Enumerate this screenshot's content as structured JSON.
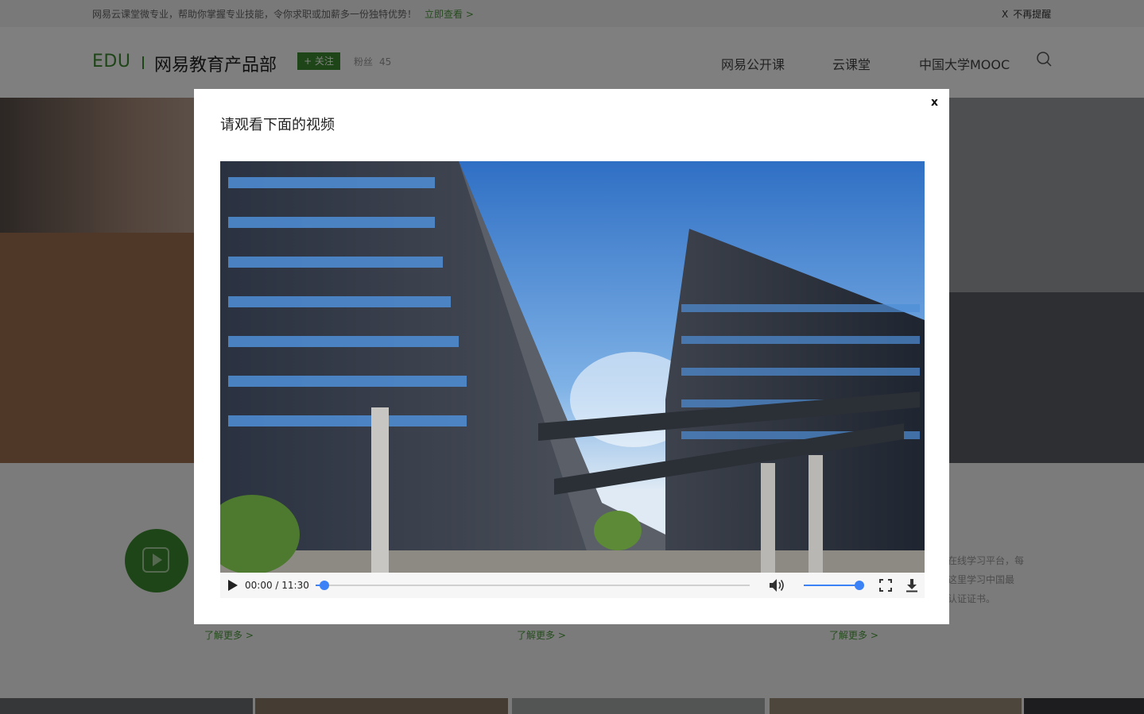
{
  "topbar": {
    "notice": "网易云课堂微专业，帮助你掌握专业技能，令你求职或加薪多一份独特优势！",
    "notice_link": "立即查看 >",
    "dismiss_mark": "X",
    "dismiss_label": "不再提醒"
  },
  "header": {
    "logo": "EDU",
    "dept_name": "网易教育产品部",
    "follow_label": "+ 关注",
    "fans_label": "粉丝",
    "fans_count": "45",
    "nav": [
      "网易公开课",
      "云课堂",
      "中国大学MOOC"
    ],
    "search_icon": "search-icon"
  },
  "features": {
    "desc_lines": [
      "的在线学习平台，每",
      "在这里学习中国最",
      "等认证证书。"
    ],
    "learn_more": [
      "了解更多 >",
      "了解更多 >",
      "了解更多 >"
    ],
    "video_icon": "video-play-icon"
  },
  "modal": {
    "close_label": "x",
    "title": "请观看下面的视频",
    "player": {
      "current_time": "00:00",
      "duration": "11:30",
      "time_display": "00:00 / 11:30",
      "progress_fraction": 0.02,
      "volume_fraction": 1.0,
      "icons": [
        "play-icon",
        "volume-icon",
        "fullscreen-icon",
        "download-icon"
      ]
    }
  },
  "colors": {
    "brand_green": "#3d8b2e",
    "link_green": "#4a9a3a",
    "player_accent": "#3b82f6",
    "overlay": "rgba(0,0,0,0.5)"
  }
}
